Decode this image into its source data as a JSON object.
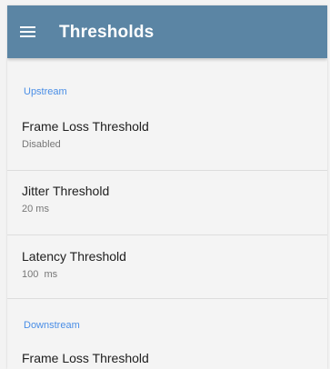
{
  "app_bar": {
    "title": "Thresholds",
    "menu_icon": "hamburger-menu-icon",
    "background_color": "#5b85a4"
  },
  "sections": [
    {
      "header": "Upstream",
      "items": [
        {
          "title": "Frame Loss Threshold",
          "value": "Disabled"
        },
        {
          "title": "Jitter Threshold",
          "value": "20 ms"
        },
        {
          "title": "Latency Threshold",
          "value": "100  ms"
        }
      ]
    },
    {
      "header": "Downstream",
      "items": [
        {
          "title": "Frame Loss Threshold",
          "value": ""
        }
      ]
    }
  ],
  "accent_color": "#4a8ee6"
}
